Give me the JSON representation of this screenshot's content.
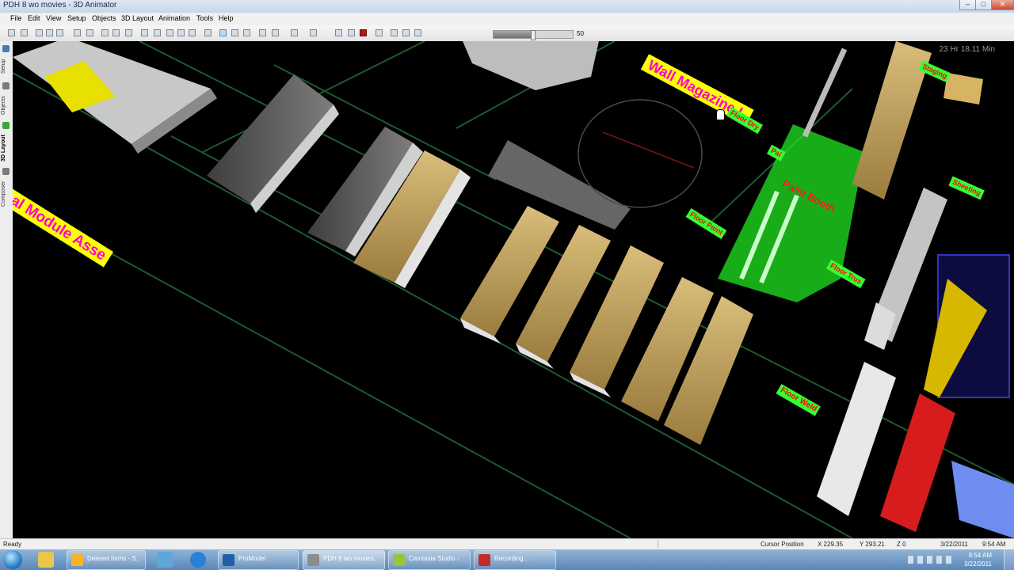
{
  "window": {
    "title": "PDH 8 wo movies - 3D Animator",
    "minimize": "–",
    "maximize": "□",
    "close": "✕"
  },
  "menu": [
    "File",
    "Edit",
    "View",
    "Setup",
    "Objects",
    "3D Layout",
    "Animation",
    "Tools",
    "Help"
  ],
  "toolbar": {
    "speed_value": "50",
    "speed_fraction": 0.5
  },
  "side_tabs": [
    "Setup",
    "Objects",
    "3D Layout",
    "Composer"
  ],
  "viewport": {
    "sim_time": "23 Hr 18.11 Min",
    "labels": {
      "final_module": "Final Module Asse",
      "wall_magazine": "Wall Magazine L",
      "floor_dry": "Floor Dry",
      "paint_booth": "Paint Booth",
      "paint_left": "Pai",
      "floor_paint": "Floor Paint",
      "floor_trus": "Floor Trus",
      "floor_weld": "Floor Weld",
      "staging": "Staging",
      "sheeting": "Sheeting"
    }
  },
  "status": {
    "left": "Ready",
    "cursor_label": "Cursor Position",
    "x": "X 229.35",
    "y": "Y 293.21",
    "z": "Z 0",
    "date": "3/22/2011",
    "time": "9:54 AM"
  },
  "taskbar": {
    "buttons": [
      "Deleted Items - S...",
      "ProModel",
      "PDH 8 wo movies...",
      "Camtasia Studio -...",
      "Recording..."
    ],
    "clock_time": "9:54 AM",
    "clock_date": "3/22/2011"
  },
  "colors": {
    "label_yellow": "#ffff00",
    "label_magenta": "#ff00cc",
    "label_green": "#33ff33",
    "label_red": "#ff0000",
    "booth_green": "#22ee22"
  }
}
